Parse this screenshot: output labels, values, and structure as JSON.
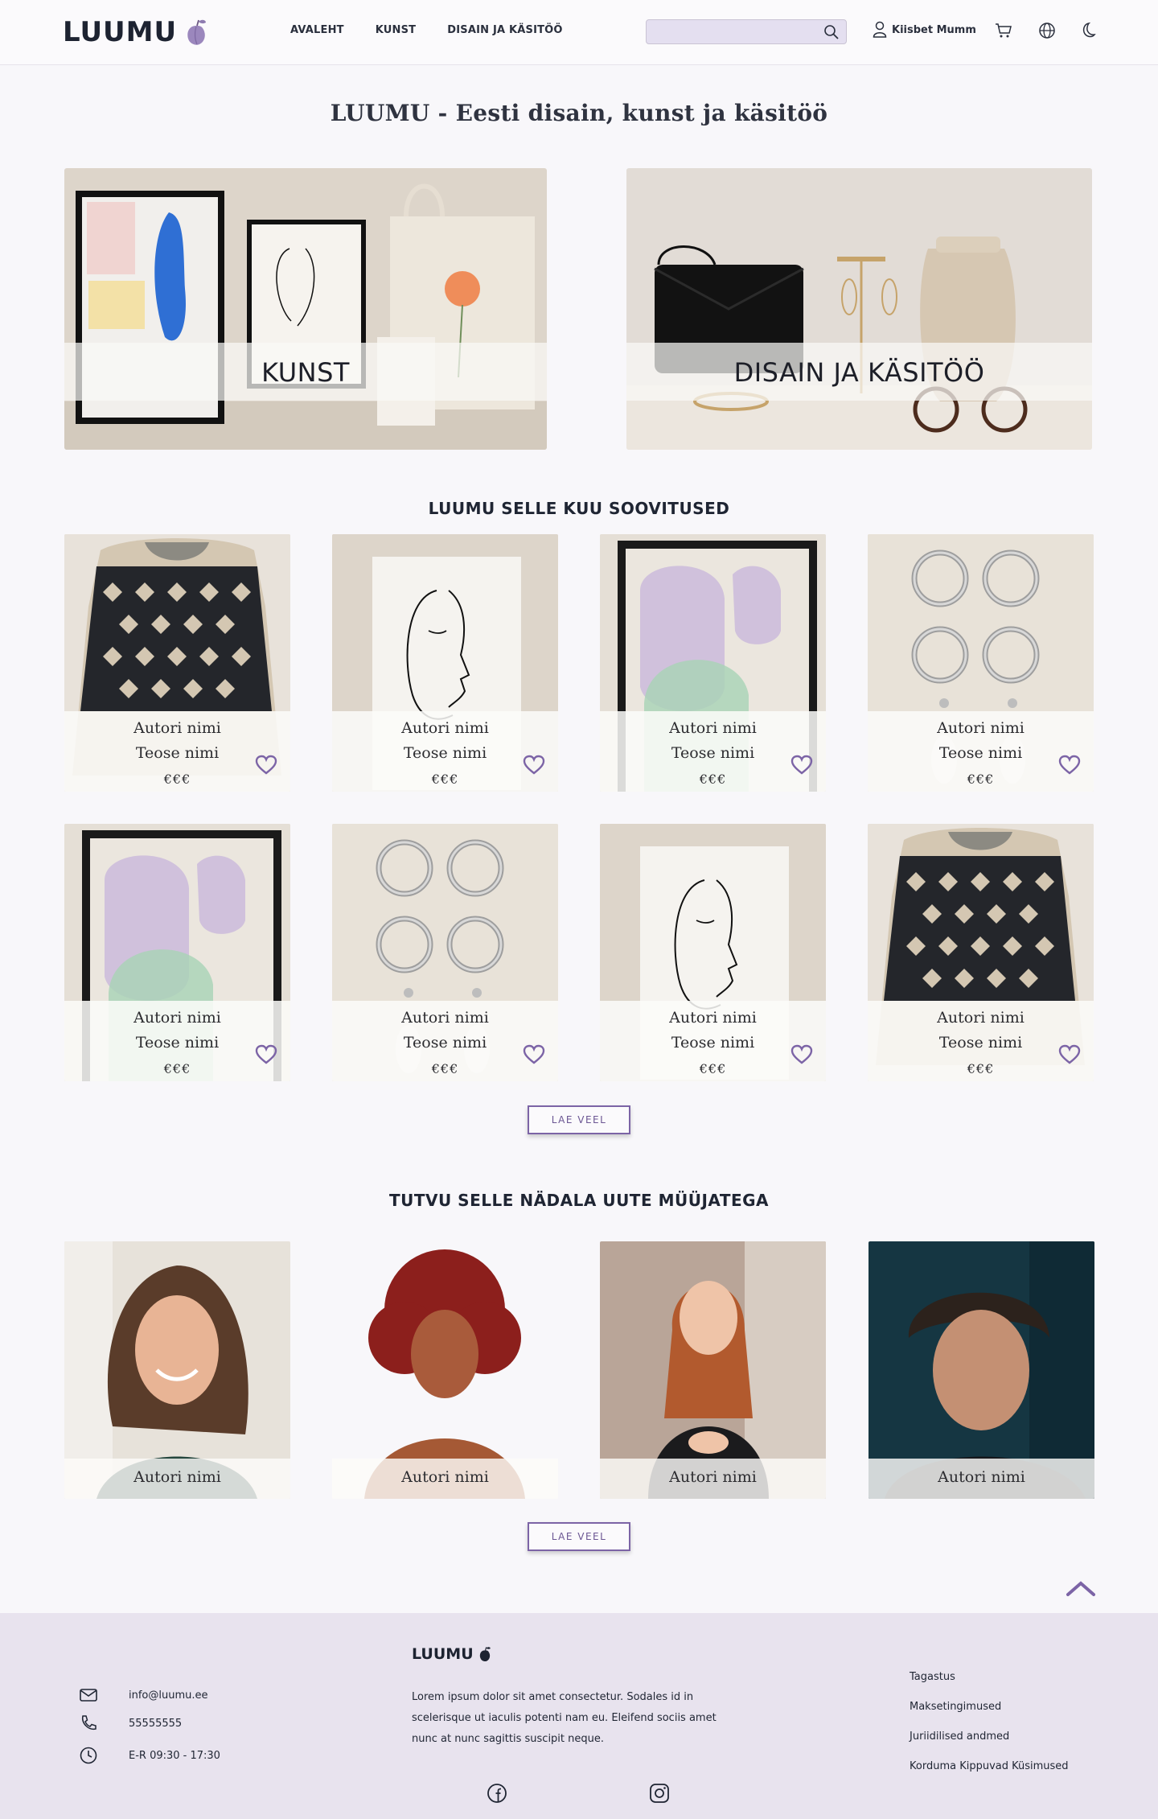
{
  "header": {
    "logo": "LUUMU",
    "nav": [
      "AVALEHT",
      "KUNST",
      "DISAIN JA KÄSITÖÖ"
    ],
    "search_placeholder": "",
    "user_name": "Kiisbet Mumm"
  },
  "page_title": "LUUMU - Eesti disain, kunst ja käsitöö",
  "hero": {
    "left_label": "KUNST",
    "right_label": "DISAIN JA KÄSITÖÖ"
  },
  "recommendations": {
    "title": "LUUMU SELLE KUU SOOVITUSED",
    "items": [
      {
        "author": "Autori nimi",
        "work": "Teose nimi",
        "price": "€€€",
        "image": "knit-vest"
      },
      {
        "author": "Autori nimi",
        "work": "Teose nimi",
        "price": "€€€",
        "image": "line-face"
      },
      {
        "author": "Autori nimi",
        "work": "Teose nimi",
        "price": "€€€",
        "image": "abstract-frame"
      },
      {
        "author": "Autori nimi",
        "work": "Teose nimi",
        "price": "€€€",
        "image": "hoop-earrings"
      },
      {
        "author": "Autori nimi",
        "work": "Teose nimi",
        "price": "€€€",
        "image": "abstract-frame"
      },
      {
        "author": "Autori nimi",
        "work": "Teose nimi",
        "price": "€€€",
        "image": "hoop-earrings"
      },
      {
        "author": "Autori nimi",
        "work": "Teose nimi",
        "price": "€€€",
        "image": "line-face"
      },
      {
        "author": "Autori nimi",
        "work": "Teose nimi",
        "price": "€€€",
        "image": "knit-vest"
      }
    ],
    "more_label": "LAE VEEL"
  },
  "sellers": {
    "title": "TUTVU SELLE NÄDALA UUTE MÜÜJATEGA",
    "items": [
      {
        "name": "Autori nimi"
      },
      {
        "name": "Autori nimi"
      },
      {
        "name": "Autori nimi"
      },
      {
        "name": "Autori nimi"
      }
    ],
    "more_label": "LAE VEEL"
  },
  "footer": {
    "email": "info@luumu.ee",
    "phone": "55555555",
    "hours": "E-R 09:30 - 17:30",
    "logo": "LUUMU",
    "text": "Lorem ipsum dolor sit amet consectetur. Sodales id in scelerisque ut iaculis potenti nam eu. Eleifend sociis amet nunc at nunc sagittis suscipit neque.",
    "links": [
      "Tagastus",
      "Maksetingimused",
      "Juriidilised andmed",
      "Korduma Kippuvad Küsimused"
    ]
  },
  "colors": {
    "accent": "#7c64a6",
    "footer_bg": "#e8e3ee",
    "page_bg": "#f8f7fa"
  }
}
